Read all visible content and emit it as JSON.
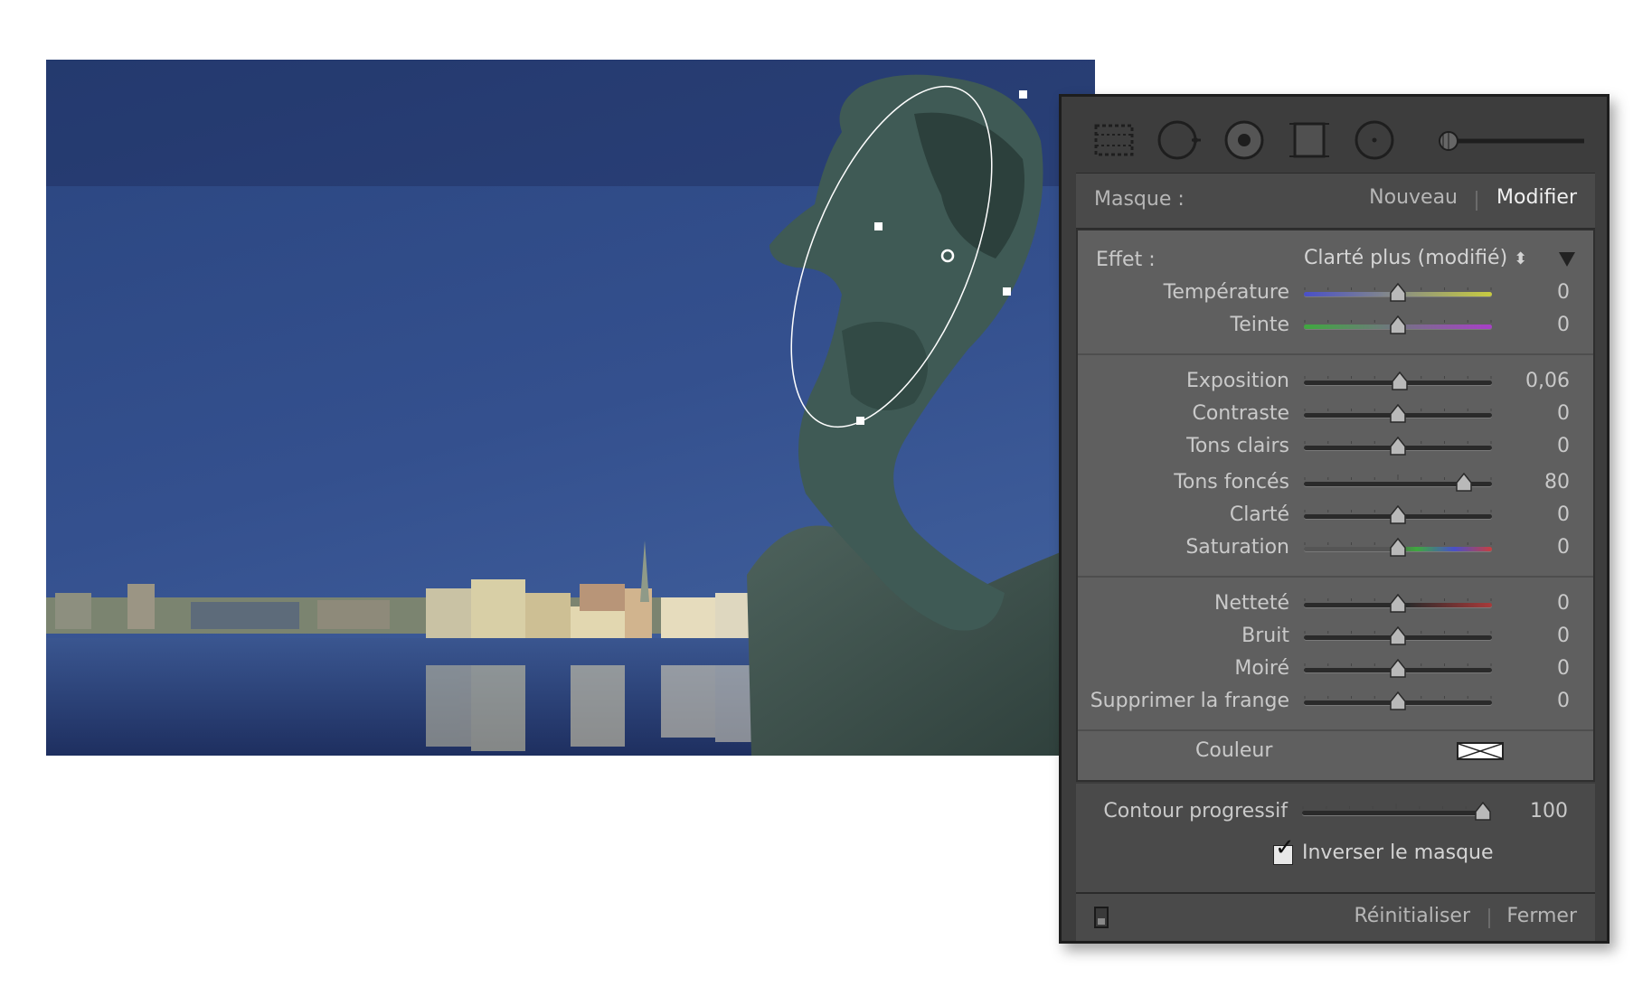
{
  "toolbar": {
    "tools": [
      "graduated-filter-icon",
      "spot-removal-icon",
      "red-eye-icon",
      "crop-icon",
      "radial-filter-icon",
      "adjustment-brush-icon"
    ]
  },
  "mask": {
    "label": "Masque :",
    "new_label": "Nouveau",
    "edit_label": "Modifier"
  },
  "effect": {
    "label": "Effet :",
    "preset": "Clarté plus (modifié)",
    "preset_arrows": "⬍"
  },
  "sliders": {
    "temperature": {
      "label": "Température",
      "value": "0",
      "position": 0.5
    },
    "tint": {
      "label": "Teinte",
      "value": "0",
      "position": 0.5
    },
    "exposure": {
      "label": "Exposition",
      "value": "0,06",
      "position": 0.51
    },
    "contrast": {
      "label": "Contraste",
      "value": "0",
      "position": 0.5
    },
    "highlights": {
      "label": "Tons clairs",
      "value": "0",
      "position": 0.5
    },
    "shadows": {
      "label": "Tons foncés",
      "value": "80",
      "position": 0.85
    },
    "clarity": {
      "label": "Clarté",
      "value": "0",
      "position": 0.5
    },
    "saturation": {
      "label": "Saturation",
      "value": "0",
      "position": 0.5
    },
    "sharpness": {
      "label": "Netteté",
      "value": "0",
      "position": 0.5
    },
    "noise": {
      "label": "Bruit",
      "value": "0",
      "position": 0.5
    },
    "moire": {
      "label": "Moiré",
      "value": "0",
      "position": 0.5
    },
    "defringe": {
      "label": "Supprimer la frange",
      "value": "0",
      "position": 0.5
    },
    "feather": {
      "label": "Contour progressif",
      "value": "100",
      "position": 0.96
    }
  },
  "color": {
    "label": "Couleur"
  },
  "invert": {
    "label": "Inverser le masque",
    "checked": true,
    "check_glyph": "✓"
  },
  "footer": {
    "reset_label": "Réinitialiser",
    "close_label": "Fermer"
  },
  "colors": {
    "sky": "#2b4584",
    "panel": "#3d3d3d",
    "section": "#5f5f5f",
    "text": "#c9c9c9",
    "bronze": "#3f5a55"
  }
}
